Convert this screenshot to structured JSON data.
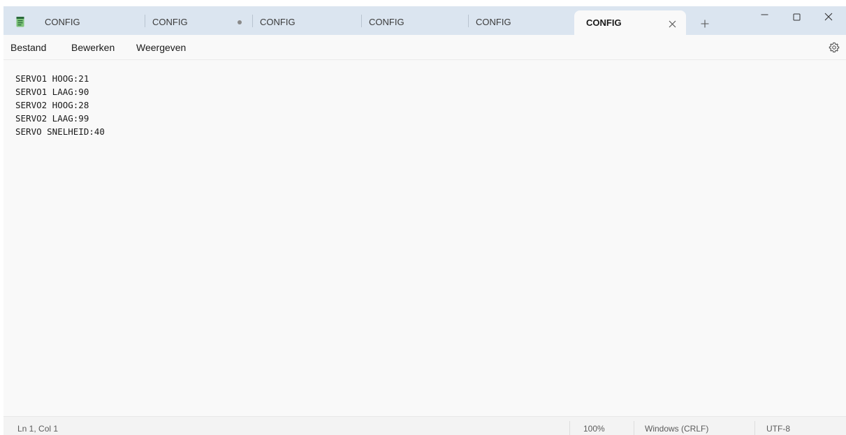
{
  "colors": {
    "titlebar_bg": "#dbe5f0",
    "content_bg": "#f9f9f9",
    "app_icon_accent": "#2a6a3a",
    "app_icon_base": "#7ec47a"
  },
  "titlebar": {
    "app_icon": "notepad-icon",
    "tabs": [
      {
        "label": "CONFIG",
        "active": false,
        "modified": false
      },
      {
        "label": "CONFIG",
        "active": false,
        "modified": true
      },
      {
        "label": "CONFIG",
        "active": false,
        "modified": false
      },
      {
        "label": "CONFIG",
        "active": false,
        "modified": false
      },
      {
        "label": "CONFIG",
        "active": false,
        "modified": false
      },
      {
        "label": "CONFIG",
        "active": true,
        "modified": false
      }
    ],
    "close_tab_icon": "close-icon",
    "new_tab_icon": "plus-icon",
    "window_controls": [
      "minimize-icon",
      "maximize-icon",
      "close-icon"
    ]
  },
  "menubar": {
    "items": [
      "Bestand",
      "Bewerken",
      "Weergeven"
    ],
    "settings_icon": "gear-icon"
  },
  "editor": {
    "lines": [
      "SERVO1 HOOG:21",
      "SERVO1 LAAG:90",
      "SERVO2 HOOG:28",
      "SERVO2 LAAG:99",
      "SERVO SNELHEID:40"
    ]
  },
  "statusbar": {
    "position": "Ln 1, Col 1",
    "zoom": "100%",
    "line_ending": "Windows (CRLF)",
    "encoding": "UTF-8"
  }
}
